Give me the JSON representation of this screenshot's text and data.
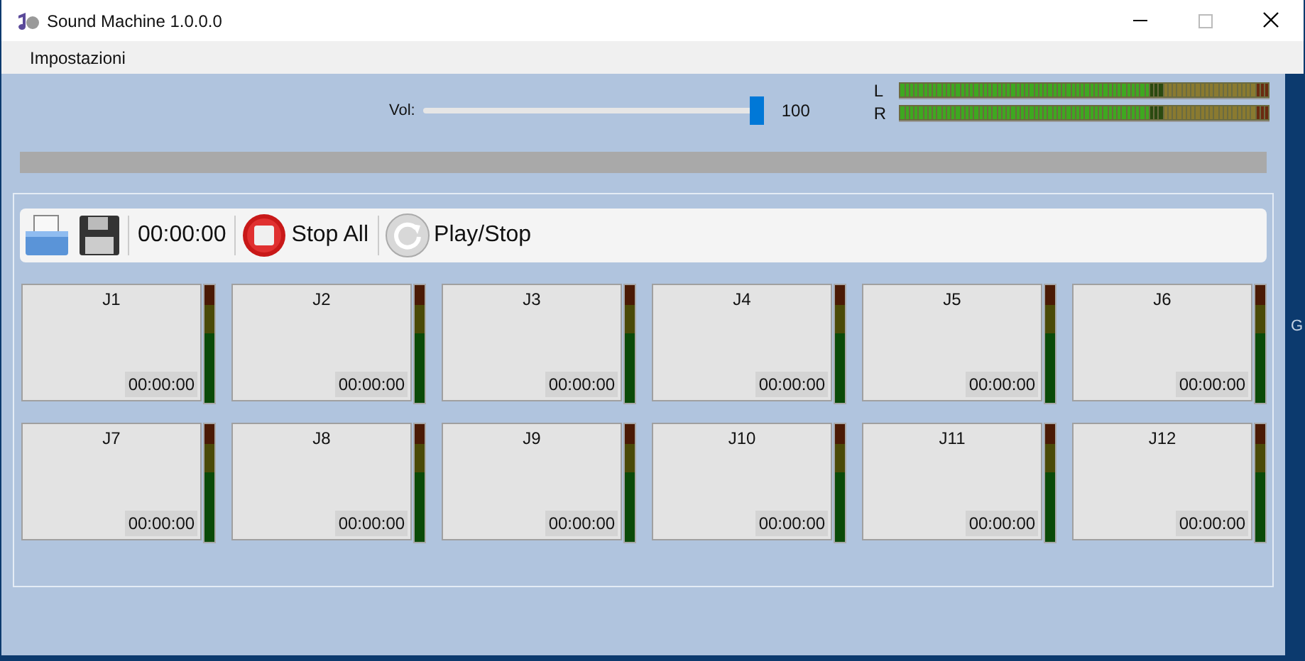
{
  "window": {
    "title": "Sound Machine 1.0.0.0"
  },
  "menu": [
    "Impostazioni"
  ],
  "volume": {
    "label": "Vol:",
    "level": 1,
    "reading": "100"
  },
  "meters": [
    {
      "label": "L",
      "level": 0.68
    },
    {
      "label": "R",
      "level": 0.68
    }
  ],
  "progress": {
    "level": 0
  },
  "toolbar": {
    "time": "00:00:00",
    "stop_all": "Stop All",
    "play_stop": "Play/Stop"
  },
  "players": [
    {
      "name": "J1",
      "time": "00:00:00"
    },
    {
      "name": "J2",
      "time": "00:00:00"
    },
    {
      "name": "J3",
      "time": "00:00:00"
    },
    {
      "name": "J4",
      "time": "00:00:00"
    },
    {
      "name": "J5",
      "time": "00:00:00"
    },
    {
      "name": "J6",
      "time": "00:00:00"
    },
    {
      "name": "J7",
      "time": "00:00:00"
    },
    {
      "name": "J8",
      "time": "00:00:00"
    },
    {
      "name": "J9",
      "time": "00:00:00"
    },
    {
      "name": "J10",
      "time": "00:00:00"
    },
    {
      "name": "J11",
      "time": "00:00:00"
    },
    {
      "name": "J12",
      "time": "00:00:00"
    }
  ],
  "edge_text": "G"
}
